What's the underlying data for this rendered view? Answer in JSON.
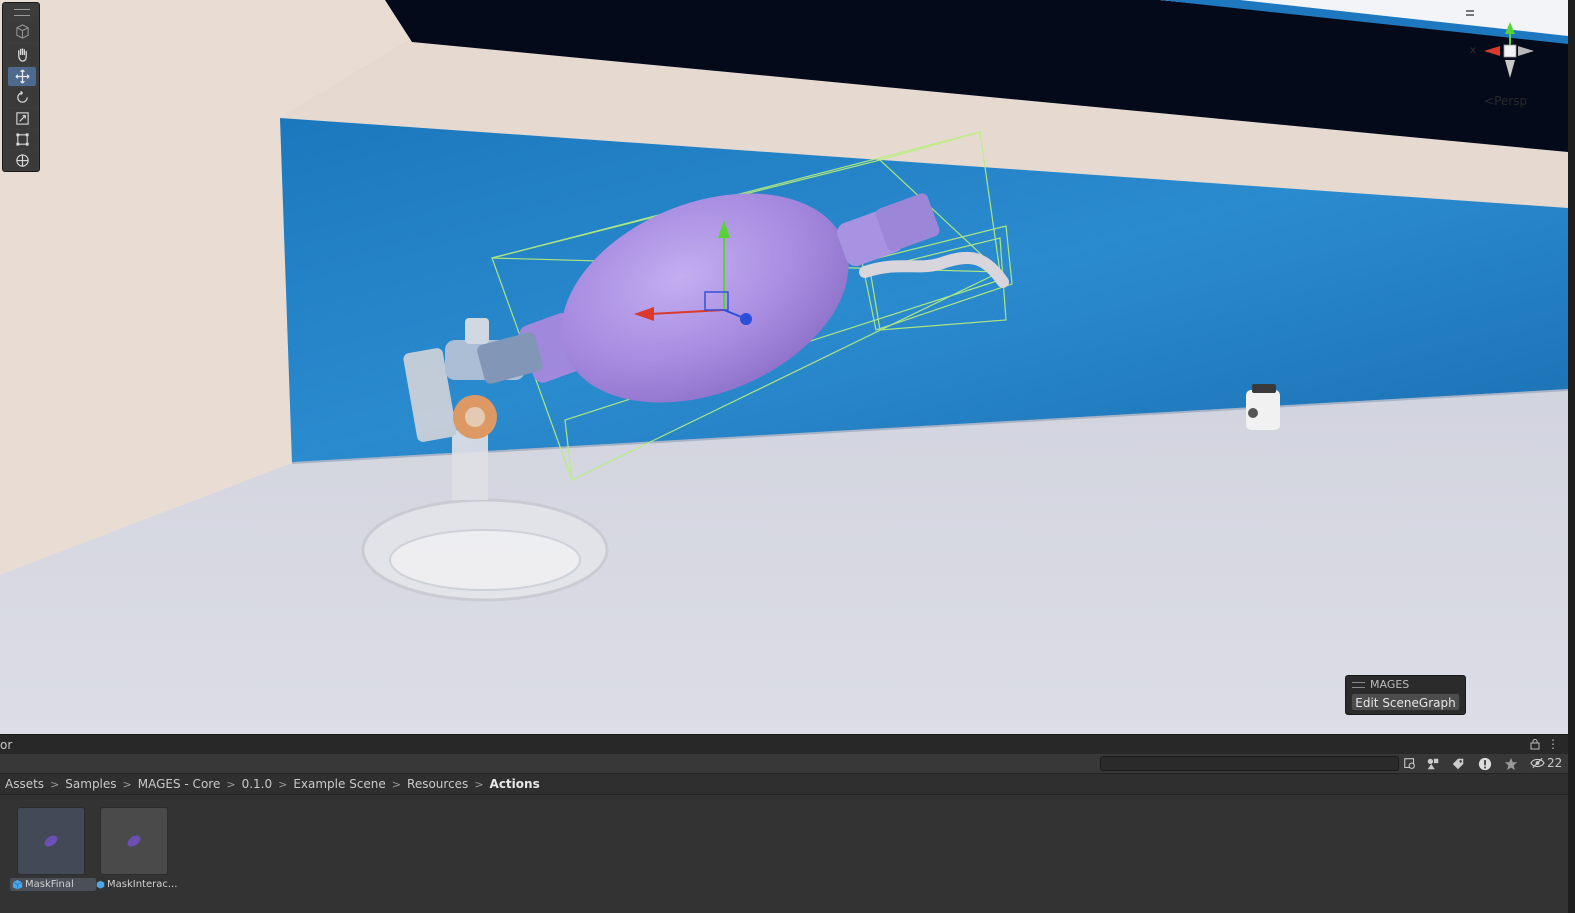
{
  "scene_view": {
    "projection_label": "Persp",
    "axis_x_label": "x",
    "tools": [
      {
        "name": "view-tool",
        "icon": "cube-icon",
        "active": false
      },
      {
        "name": "hand-tool",
        "icon": "hand-icon",
        "active": false
      },
      {
        "name": "move-tool",
        "icon": "move-arrows-icon",
        "active": true
      },
      {
        "name": "rotate-tool",
        "icon": "rotate-icon",
        "active": false
      },
      {
        "name": "scale-tool",
        "icon": "scale-icon",
        "active": false
      },
      {
        "name": "rect-tool",
        "icon": "rect-transform-icon",
        "active": false
      },
      {
        "name": "transform-tool",
        "icon": "transform-icon",
        "active": false
      }
    ],
    "overlay": {
      "title": "MAGES",
      "button_label": "Edit SceneGraph"
    },
    "colors": {
      "gizmo_x": "#d93a2b",
      "gizmo_y": "#58d235",
      "gizmo_z": "#2b4fd8",
      "selection_outline": "#b8f07a",
      "bag": "#a98ce0",
      "wall": "#1f7fc4"
    }
  },
  "project_panel": {
    "tab_label": "or",
    "search": {
      "value": "",
      "placeholder": ""
    },
    "hidden_count": "22",
    "breadcrumb": [
      "Assets",
      "Samples",
      "MAGES - Core",
      "0.1.0",
      "Example Scene",
      "Resources",
      "Actions"
    ],
    "assets": [
      {
        "label": "MaskFinal",
        "icon": "prefab-cube-icon",
        "selected": true
      },
      {
        "label": "MaskInterac...",
        "icon": "prefab-cube-icon",
        "selected": false
      }
    ]
  }
}
